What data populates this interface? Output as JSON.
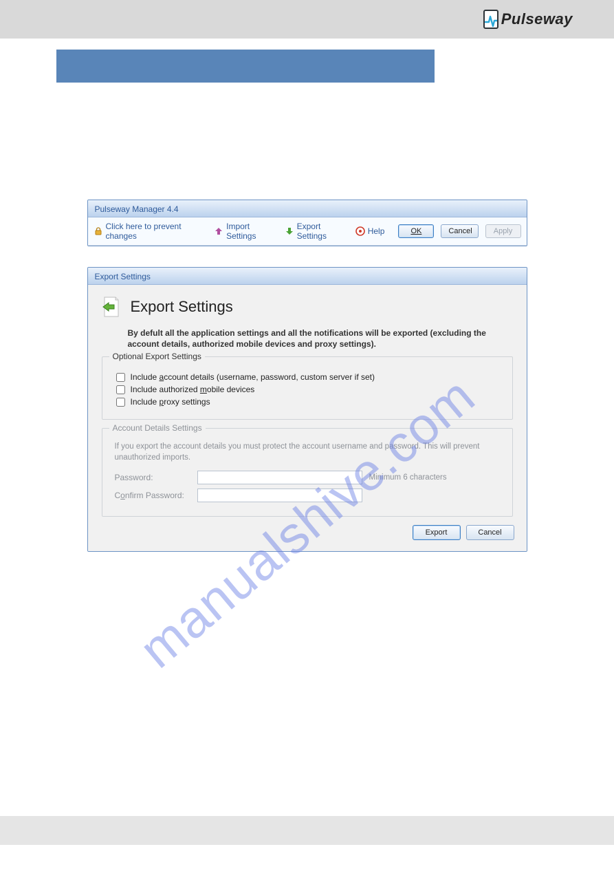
{
  "brand": {
    "name": "Pulseway"
  },
  "watermark": "manualshive.com",
  "manager_window": {
    "title": "Pulseway Manager 4.4",
    "toolbar": {
      "prevent_changes": "Click here to prevent changes",
      "import_settings": "Import Settings",
      "export_settings": "Export Settings",
      "help": "Help",
      "ok": "OK",
      "cancel": "Cancel",
      "apply": "Apply"
    }
  },
  "export_dialog": {
    "title": "Export Settings",
    "heading": "Export Settings",
    "description": "By defult all the application settings and all the notifications will be exported (excluding the account details, authorized mobile devices and proxy settings).",
    "optional_group": {
      "legend": "Optional Export Settings",
      "include_account_pre": "Include ",
      "include_account_u": "a",
      "include_account_post": "ccount details (username, password, custom server if set)",
      "include_mobile_pre": "Include authorized ",
      "include_mobile_u": "m",
      "include_mobile_post": "obile devices",
      "include_proxy_pre": "Include ",
      "include_proxy_u": "p",
      "include_proxy_post": "roxy settings"
    },
    "account_group": {
      "legend": "Account Details Settings",
      "note": "If you export the account details you must protect the account username and password. This will prevent unauthorized imports.",
      "password_label": "Password:",
      "confirm_label_pre": "C",
      "confirm_label_u": "o",
      "confirm_label_post": "nfirm Password:",
      "min_note": "Minimum 6 characters"
    },
    "buttons": {
      "export": "Export",
      "cancel": "Cancel"
    }
  }
}
